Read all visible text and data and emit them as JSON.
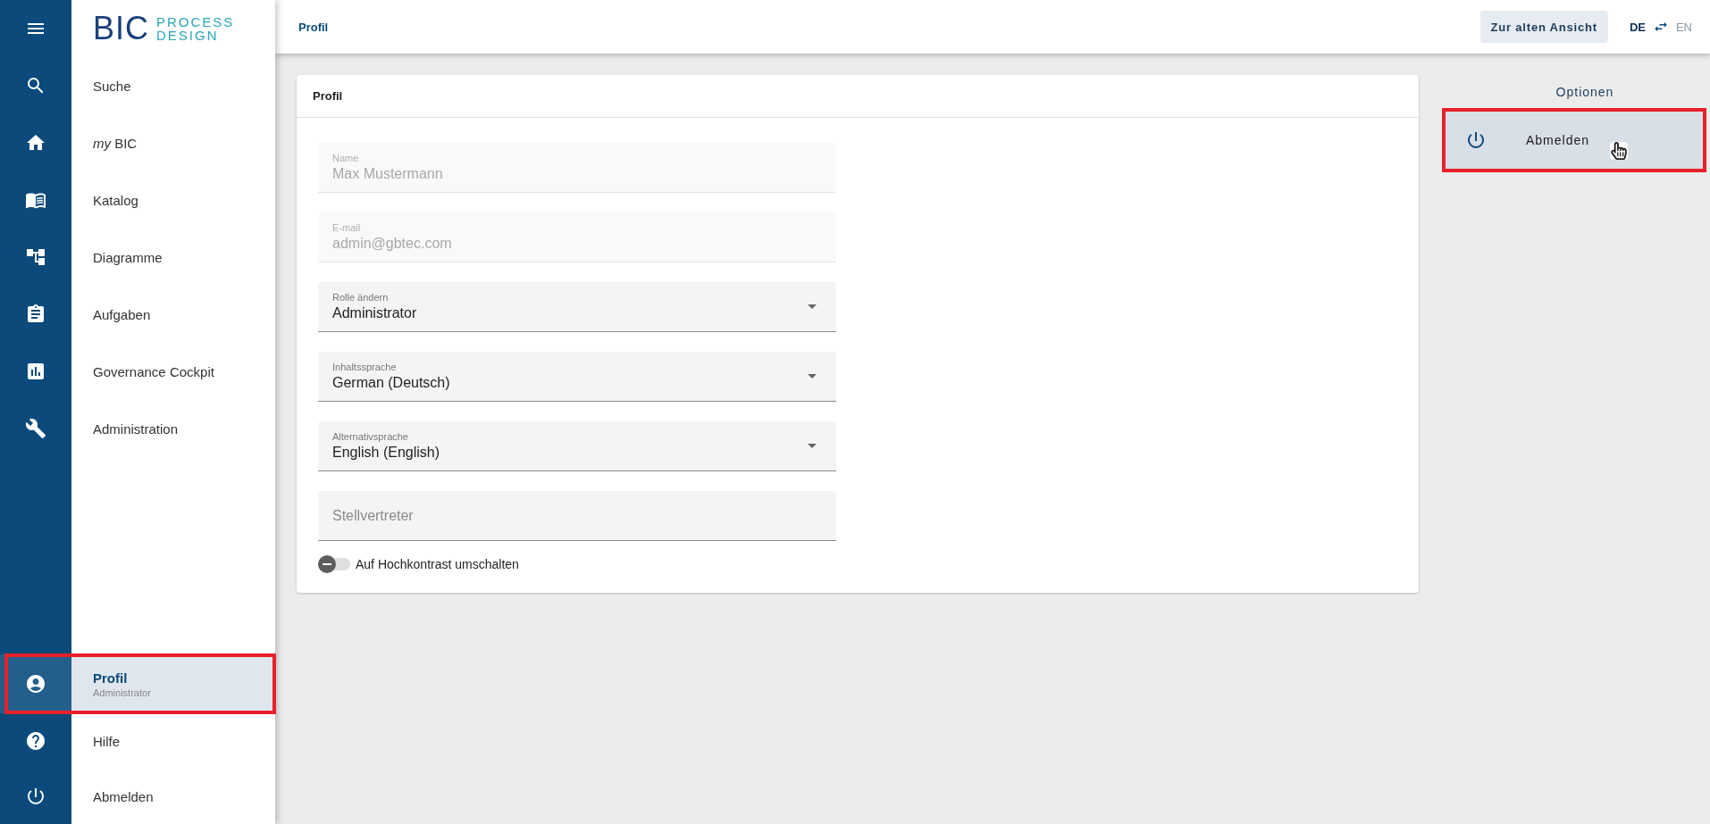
{
  "sidebar": {
    "logo": {
      "brand": "BIC",
      "line1": "PROCESS",
      "line2": "DESIGN"
    },
    "items": [
      {
        "label": "Suche",
        "selected": false
      },
      {
        "label": "*my* BIC",
        "selected": false
      },
      {
        "label": "Katalog",
        "selected": false
      },
      {
        "label": "Diagramme",
        "selected": false
      },
      {
        "label": "Aufgaben",
        "selected": false
      },
      {
        "label": "Governance Cockpit",
        "selected": false
      },
      {
        "label": "Administration",
        "selected": false
      }
    ],
    "footer_items": [
      {
        "label": "Profil",
        "subtitle": "Administrator",
        "selected": true,
        "highlighted": true
      },
      {
        "label": "Hilfe",
        "selected": false,
        "highlighted": false
      },
      {
        "label": "Abmelden",
        "selected": false,
        "highlighted": false
      }
    ]
  },
  "header": {
    "title": "Profil",
    "old_view_button": "Zur alten Ansicht",
    "languages": [
      {
        "code": "DE",
        "selected": true
      },
      {
        "code": "EN",
        "selected": false
      }
    ]
  },
  "profile_card": {
    "title": "Profil",
    "fields": [
      {
        "kind": "text",
        "label": "Name",
        "value": "Max Mustermann",
        "disabled": true
      },
      {
        "kind": "text",
        "label": "E-mail",
        "value": "admin@gbtec.com",
        "disabled": true
      },
      {
        "kind": "select",
        "label": "Rolle ändern",
        "value": "Administrator",
        "disabled": false
      },
      {
        "kind": "select",
        "label": "Inhaltssprache",
        "value": "German (Deutsch)",
        "disabled": false
      },
      {
        "kind": "select",
        "label": "Alternativsprache",
        "value": "English (English)",
        "disabled": false
      },
      {
        "kind": "text",
        "placeholder": "Stellvertreter",
        "disabled": false
      }
    ],
    "toggle": {
      "label": "Auf Hochkontrast umschalten",
      "on": false
    }
  },
  "options": {
    "title": "Optionen",
    "items": [
      {
        "label": "Abmelden",
        "hovered": true,
        "highlighted": true
      }
    ]
  }
}
